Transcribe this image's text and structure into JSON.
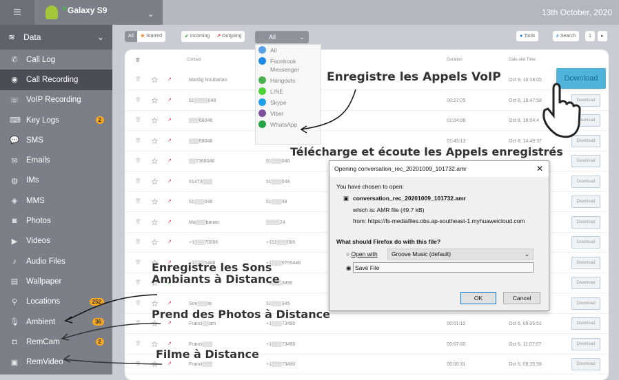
{
  "header": {
    "device": "Galaxy S9",
    "date": "13th October, 2020"
  },
  "sidebar": {
    "section": "Data",
    "items": [
      {
        "label": "Call Log",
        "icon": "phone-icon"
      },
      {
        "label": "Call Recording",
        "icon": "call-recording-icon",
        "active": true
      },
      {
        "label": "VoIP Recording",
        "icon": "voip-icon"
      },
      {
        "label": "Key Logs",
        "icon": "keyboard-icon",
        "badge": "2"
      },
      {
        "label": "SMS",
        "icon": "chat-icon"
      },
      {
        "label": "Emails",
        "icon": "mail-icon"
      },
      {
        "label": "IMs",
        "icon": "im-icon"
      },
      {
        "label": "MMS",
        "icon": "mms-icon"
      },
      {
        "label": "Photos",
        "icon": "camera-icon"
      },
      {
        "label": "Videos",
        "icon": "video-icon"
      },
      {
        "label": "Audio Files",
        "icon": "audio-icon"
      },
      {
        "label": "Wallpaper",
        "icon": "image-icon"
      },
      {
        "label": "Locations",
        "icon": "location-icon",
        "badge": "252"
      },
      {
        "label": "Ambient",
        "icon": "mic-icon",
        "badge": "36"
      },
      {
        "label": "RemCam",
        "icon": "remcam-icon",
        "badge": "2"
      },
      {
        "label": "RemVideo",
        "icon": "remvideo-icon"
      }
    ]
  },
  "toolbar": {
    "all": "All",
    "starred": "Starred",
    "incoming": "Incoming",
    "outgoing": "Outgoing",
    "app_select": "All",
    "tools": "Tools",
    "search": "Search",
    "page": "1"
  },
  "dropdown": [
    {
      "label": "All",
      "color": "#5aa0e6"
    },
    {
      "label": "Facebook Messenger",
      "color": "#1e88e5"
    },
    {
      "label": "Hangouts",
      "color": "#4caf50"
    },
    {
      "label": "LINE",
      "color": "#4cd137"
    },
    {
      "label": "Skype",
      "color": "#1ea0e6"
    },
    {
      "label": "Viber",
      "color": "#7b519d"
    },
    {
      "label": "WhatsApp",
      "color": "#25a244"
    }
  ],
  "table": {
    "headers": {
      "contact": "Contact",
      "duration": "Duration",
      "date": "Date and Time"
    },
    "download": "Download",
    "rows": [
      {
        "contact": "Mardig Noubarian",
        "number": "",
        "duration": "",
        "date": "Oct 9, 10:18:05",
        "dir": "out"
      },
      {
        "contact": "51▒▒▒▒048",
        "number": "",
        "duration": "00:27:25",
        "date": "Oct 8, 16:47:58",
        "dir": "out"
      },
      {
        "contact": "▒▒▒68048",
        "number": "",
        "duration": "01:04:08",
        "date": "Oct 8, 16:04:4",
        "dir": "out"
      },
      {
        "contact": "▒▒▒68048",
        "number": "",
        "duration": "01:43:13",
        "date": "Oct 8, 14:49:37",
        "dir": "out"
      },
      {
        "contact": "▒▒7368048",
        "number": "51▒▒▒048",
        "duration": "",
        "date": "",
        "dir": "out"
      },
      {
        "contact": "51473▒▒▒",
        "number": "51▒▒▒048",
        "duration": "",
        "date": "",
        "dir": "out"
      },
      {
        "contact": "51▒▒▒048",
        "number": "51▒▒▒48",
        "duration": "",
        "date": "",
        "dir": "out"
      },
      {
        "contact": "Ma▒▒▒barian",
        "number": "▒▒▒▒24",
        "duration": "",
        "date": "",
        "dir": "out"
      },
      {
        "contact": "+1▒▒▒70006",
        "number": "+151▒▒▒006",
        "duration": "",
        "date": "",
        "dir": "out"
      },
      {
        "contact": "+1▒▒▒5448",
        "number": "+1▒▒▒6705448",
        "duration": "",
        "date": "",
        "dir": "out"
      },
      {
        "contact": "",
        "number": "+1▒▒▒3490",
        "duration": "",
        "date": "",
        "dir": "in"
      },
      {
        "contact": "Son▒▒▒te",
        "number": "51▒▒▒345",
        "duration": "",
        "date": "",
        "dir": "out"
      },
      {
        "contact": "Franci▒▒am",
        "number": "+1▒▒▒73490",
        "duration": "00:01:10",
        "date": "Oct 6, 09:05:51",
        "dir": "out"
      },
      {
        "contact": "Franci▒▒▒",
        "number": "+1▒▒▒73490",
        "duration": "00:07:00",
        "date": "Oct 5, 11:07:07",
        "dir": "out"
      },
      {
        "contact": "Franci▒▒▒",
        "number": "+1▒▒▒73490",
        "duration": "00:00:31",
        "date": "Oct 5, 08:25:58",
        "dir": "out"
      }
    ]
  },
  "dialog": {
    "title": "Opening conversation_rec_20201009_101732.amr",
    "chosen": "You have chosen to open:",
    "file": "conversation_rec_20201009_101732.amr",
    "which_label": "which is:",
    "which": "AMR file (49.7 kB)",
    "from_label": "from:",
    "from": "https://fs-mediafiles.obs.ap-southeast-1.myhuaweicloud.com",
    "question": "What should Firefox do with this file?",
    "open_with": "Open with",
    "app": "Groove Music (default)",
    "save": "Save File",
    "ok": "OK",
    "cancel": "Cancel"
  },
  "annotations": {
    "voip": "Enregistre les Appels VoIP",
    "download": "Télécharge et écoute les Appels enregistrés",
    "ambient1": "Enregistre les Sons",
    "ambient2": "Ambiants à Distance",
    "photos": "Prend des Photos à Distance",
    "video": "Filme à Distance"
  }
}
